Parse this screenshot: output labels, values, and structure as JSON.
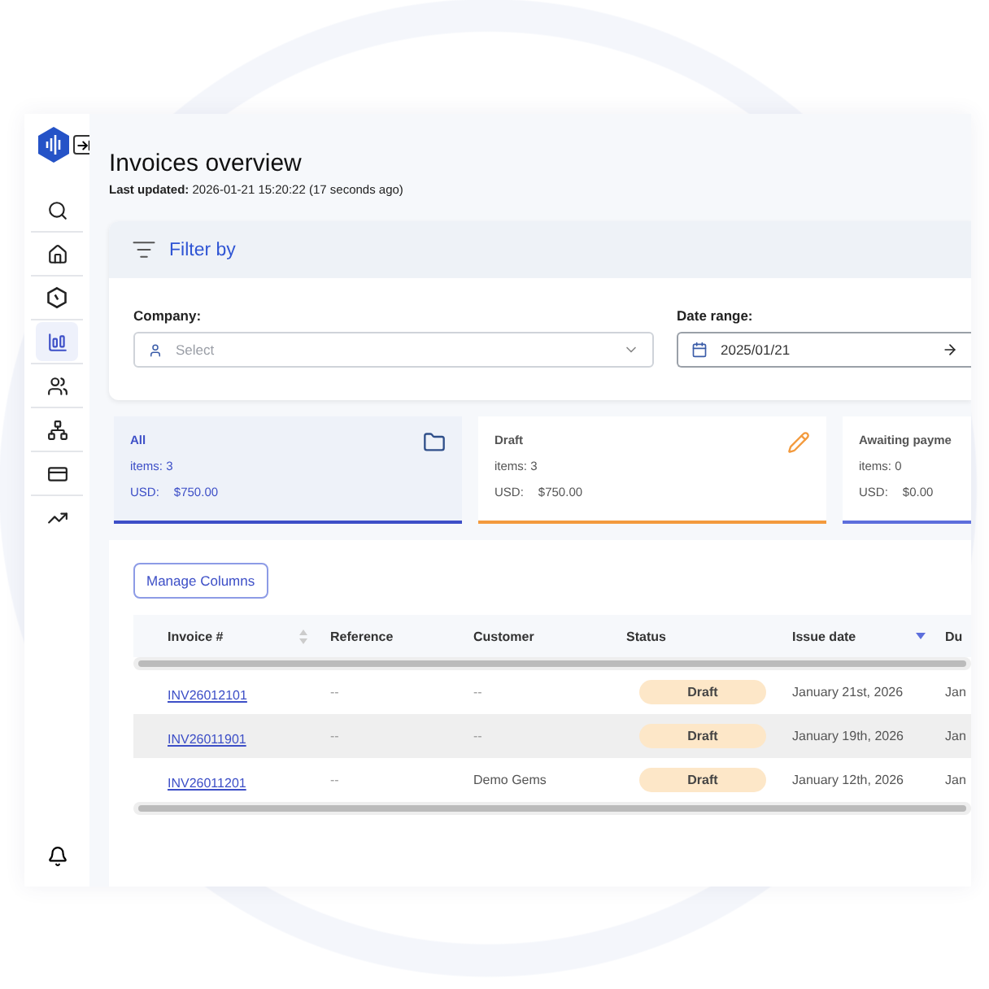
{
  "sidebar": {
    "items": [
      {
        "kind": "search",
        "selected": false
      },
      {
        "kind": "home",
        "selected": false
      },
      {
        "kind": "gauge",
        "selected": false
      },
      {
        "kind": "chart",
        "selected": true
      },
      {
        "kind": "users",
        "selected": false
      },
      {
        "kind": "network",
        "selected": false
      },
      {
        "kind": "card",
        "selected": false
      },
      {
        "kind": "trend",
        "selected": false
      }
    ]
  },
  "header": {
    "title": "Invoices overview",
    "last_updated": "**Last updated:** 2026-01-21 15:20:22 (17 seconds ago)"
  },
  "filter": {
    "title": "Filter by",
    "company": {
      "label": "Company:",
      "placeholder": "Select"
    },
    "date_range": {
      "label": "Date range:",
      "value": "2025/01/21"
    }
  },
  "status_cards": [
    {
      "kind": "folder",
      "title": "All",
      "items": "items: 3",
      "currency": "USD:",
      "amount": "$750.00",
      "color": "#3d4fc7",
      "selected": true
    },
    {
      "kind": "pencil",
      "title": "Draft",
      "items": "items: 3",
      "currency": "USD:",
      "amount": "$750.00",
      "color": "#f39a3d",
      "selected": false
    },
    {
      "kind": "none",
      "title": "Awaiting payme",
      "items": "items: 0",
      "currency": "USD:",
      "amount": "$0.00",
      "color": "#5d6fdc",
      "selected": false
    }
  ],
  "table": {
    "manage_button": "Manage Columns",
    "columns": [
      {
        "label": "Invoice #",
        "sortable": true,
        "sorted": false
      },
      {
        "label": "Reference"
      },
      {
        "label": "Customer"
      },
      {
        "label": "Status"
      },
      {
        "label": "Issue date",
        "sortable": true,
        "sorted": true
      },
      {
        "label": "Du"
      }
    ],
    "rows": [
      {
        "invoice": "INV26012101",
        "reference": "--",
        "customer": "--",
        "status": "Draft",
        "issue_date": "January 21st, 2026",
        "due": "Jan"
      },
      {
        "invoice": "INV26011901",
        "reference": "--",
        "customer": "--",
        "status": "Draft",
        "issue_date": "January 19th, 2026",
        "due": "Jan"
      },
      {
        "invoice": "INV26011201",
        "reference": "--",
        "customer": "Demo Gems",
        "status": "Draft",
        "issue_date": "January 12th, 2026",
        "due": "Jan"
      }
    ]
  }
}
